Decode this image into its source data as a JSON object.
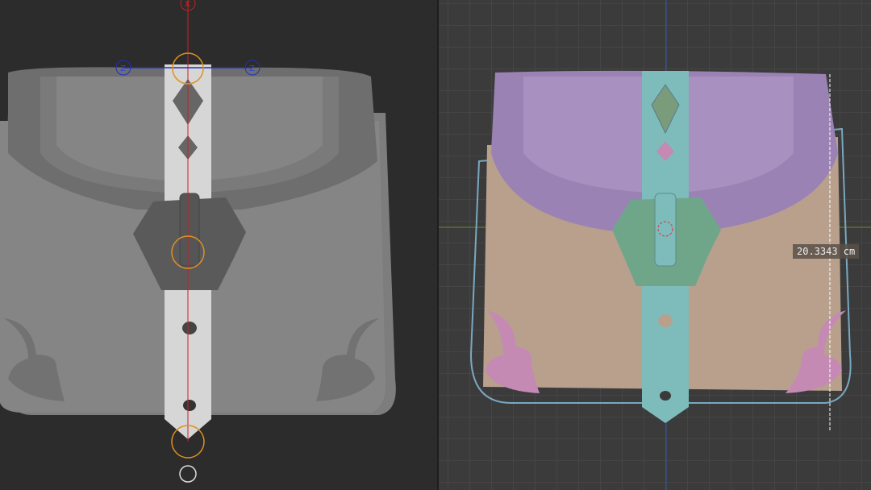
{
  "left_viewport": {
    "gizmo_labels": {
      "x": "X",
      "z_left": "Z",
      "z_right": "Z"
    }
  },
  "right_viewport": {
    "measurement": "20.3343 cm"
  },
  "colors": {
    "left_mesh": "#8a8a8a",
    "strap_left": "#d8d8d8",
    "flap_right": "#9b82b4",
    "body_right": "#b8a08c",
    "strap_right": "#7ebcbc",
    "buckle_right": "#6fa68a",
    "ornament_right": "#c48ab4"
  }
}
